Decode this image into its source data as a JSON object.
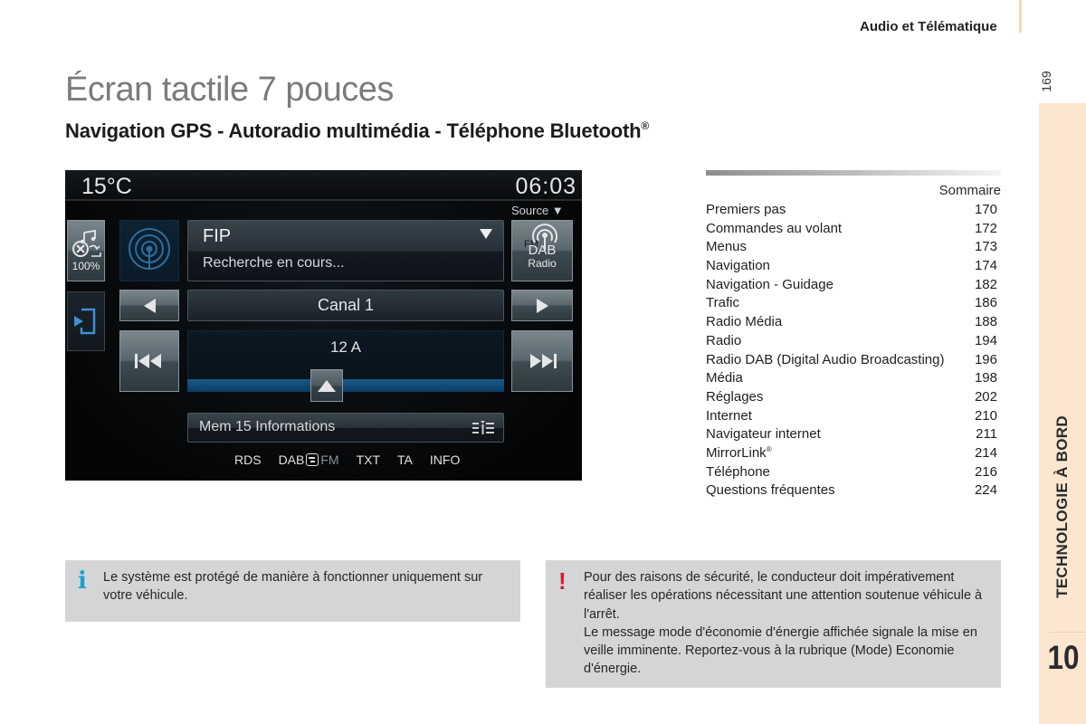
{
  "header": {
    "running_head": "Audio et Télématique",
    "page_number": "169"
  },
  "side_tab": {
    "label": "TECHNOLOGIE À BORD",
    "chapter": "10"
  },
  "title": "Écran tactile 7 pouces",
  "subtitle": {
    "text": "Navigation GPS - Autoradio multimédia - Téléphone Bluetooth",
    "mark": "®"
  },
  "screen": {
    "temperature": "15°C",
    "clock": "06:03",
    "source_label": "Source ▼",
    "volume_button": {
      "label": "100%",
      "icon": "music-mute-icon"
    },
    "back_button": {
      "icon": "exit-icon"
    },
    "signal_icon": "radio-signal-icon",
    "station": {
      "name": "FIP",
      "status": "Recherche en cours..."
    },
    "source_button": {
      "fm": "FM",
      "dab": "DAB",
      "radio": "Radio"
    },
    "channel": "Canal 1",
    "frequency": "12 A",
    "tuning_position": 0.44,
    "preset": "Mem 15 Informations",
    "bottom_bar": {
      "rds": "RDS",
      "dab": "DAB",
      "fm": "FM",
      "txt": "TXT",
      "ta": "TA",
      "info": "INFO"
    },
    "colors": {
      "tuning_bar": "#1a5a87",
      "signal_icon": "#2d6d9f",
      "exit_icon": "#3d8fd6"
    }
  },
  "toc": {
    "title": "Sommaire",
    "items": [
      {
        "label": "Premiers pas",
        "page": "170"
      },
      {
        "label": "Commandes au volant",
        "page": "172"
      },
      {
        "label": "Menus",
        "page": "173"
      },
      {
        "label": "Navigation",
        "page": "174"
      },
      {
        "label": "Navigation - Guidage",
        "page": "182"
      },
      {
        "label": "Trafic",
        "page": "186"
      },
      {
        "label": "Radio Média",
        "page": "188"
      },
      {
        "label": "Radio",
        "page": "194"
      },
      {
        "label": "Radio DAB (Digital Audio Broadcasting)",
        "page": "196"
      },
      {
        "label": "Média",
        "page": "198"
      },
      {
        "label": "Réglages",
        "page": "202"
      },
      {
        "label": "Internet",
        "page": "210"
      },
      {
        "label": "Navigateur internet",
        "page": "211"
      },
      {
        "label": "MirrorLink",
        "mark": "®",
        "page": "214"
      },
      {
        "label": "Téléphone",
        "page": "216"
      },
      {
        "label": "Questions fréquentes",
        "page": "224"
      }
    ]
  },
  "notes": {
    "info": {
      "icon": "i",
      "text": "Le système est protégé de manière à fonctionner uniquement sur votre véhicule."
    },
    "warning": {
      "icon": "!",
      "paragraphs": [
        "Pour des raisons de sécurité, le conducteur doit impérativement réaliser les opérations nécessitant une attention soutenue véhicule à l'arrêt.",
        "Le message mode d'économie d'énergie affichée signale la mise en veille imminente. Reportez-vous à la rubrique (Mode) Economie d'énergie."
      ]
    }
  },
  "colors": {
    "side_tab": "#fde6cf",
    "info_icon": "#1aa1d4",
    "warning_icon": "#d51a30",
    "note_background": "#d4d5d7"
  }
}
